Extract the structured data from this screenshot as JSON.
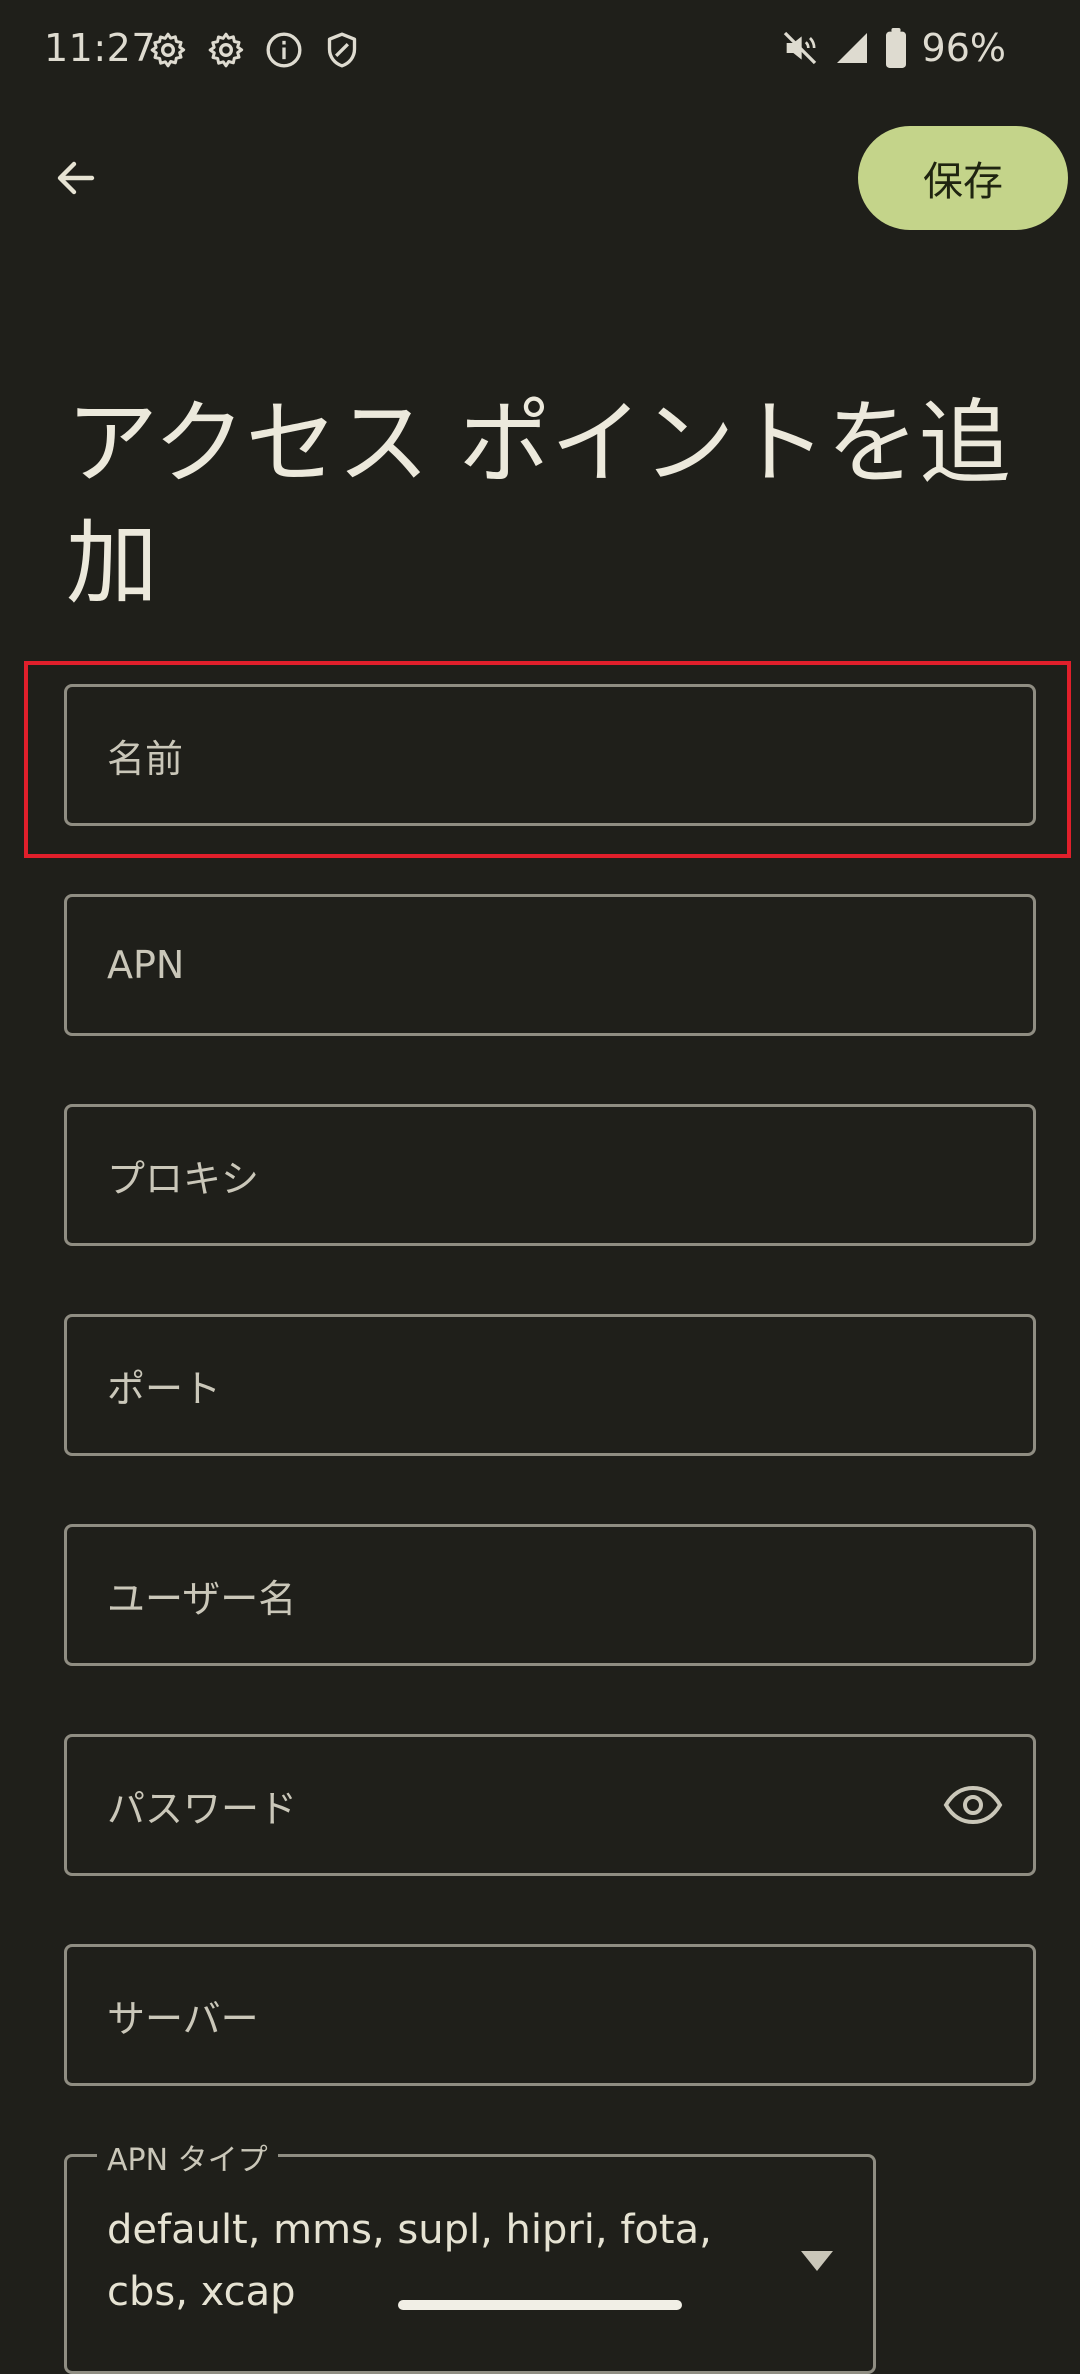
{
  "status_bar": {
    "time": "11:27",
    "battery_percent": "96%",
    "left_icons": [
      "gear-icon",
      "gear-icon",
      "info-icon",
      "shield-icon"
    ],
    "right_icons": [
      "mute-icon",
      "signal-icon",
      "battery-icon"
    ]
  },
  "app_bar": {
    "back_icon": "arrow-left-icon",
    "save_label": "保存"
  },
  "title": "アクセス ポイントを追加",
  "fields": [
    {
      "label": "名前"
    },
    {
      "label": "APN"
    },
    {
      "label": "プロキシ"
    },
    {
      "label": "ポート"
    },
    {
      "label": "ユーザー名"
    },
    {
      "label": "パスワード",
      "trailing_icon": "eye-icon"
    },
    {
      "label": "サーバー"
    }
  ],
  "apn_type": {
    "label": "APN タイプ",
    "value": "default, mms, supl, hipri, fota, cbs, xcap"
  },
  "colors": {
    "background": "#1f1f1a",
    "accent": "#c4d48a",
    "highlight": "#e01f2b",
    "outline": "#8f8d82"
  }
}
